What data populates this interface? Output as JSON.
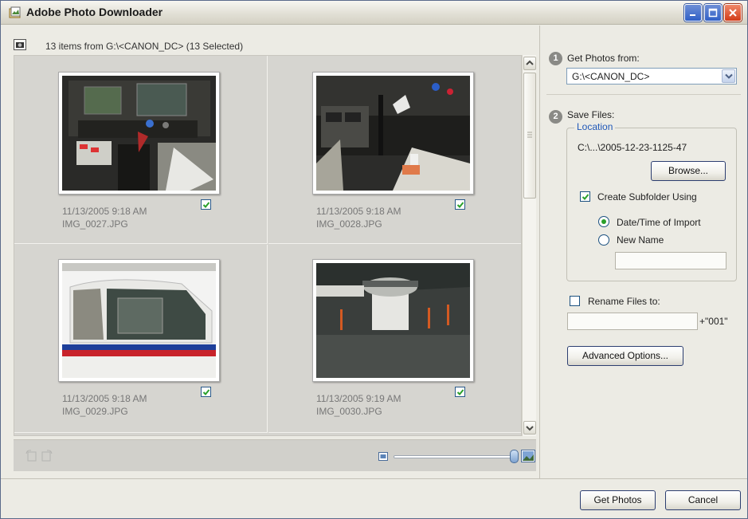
{
  "window": {
    "title": "Adobe Photo Downloader"
  },
  "source": {
    "summary": "13 items from G:\\<CANON_DC> (13 Selected)"
  },
  "thumbnails": [
    {
      "date": "11/13/2005 9:18 AM",
      "name": "IMG_0027.JPG",
      "checked": true
    },
    {
      "date": "11/13/2005 9:18 AM",
      "name": "IMG_0028.JPG",
      "checked": true
    },
    {
      "date": "11/13/2005 9:18 AM",
      "name": "IMG_0029.JPG",
      "checked": true
    },
    {
      "date": "11/13/2005 9:19 AM",
      "name": "IMG_0030.JPG",
      "checked": true
    }
  ],
  "get_photos_from": {
    "step": "1",
    "label": "Get Photos from:",
    "value": "G:\\<CANON_DC>"
  },
  "save_files": {
    "step": "2",
    "label": "Save Files:",
    "location_legend": "Location",
    "path": "C:\\...\\2005-12-23-1125-47",
    "browse_label": "Browse...",
    "create_subfolder_label": "Create Subfolder Using",
    "create_subfolder_checked": true,
    "radio_datetime_label": "Date/Time of Import",
    "radio_newname_label": "New Name",
    "selected_radio": "datetime",
    "new_name_value": ""
  },
  "rename": {
    "label": "Rename Files to:",
    "checked": false,
    "value": "",
    "suffix": "+\"001\""
  },
  "advanced_label": "Advanced Options...",
  "footer": {
    "get_photos_label": "Get Photos",
    "cancel_label": "Cancel"
  },
  "colors": {
    "accent_blue": "#2058b8",
    "check_green": "#2aa02a"
  }
}
